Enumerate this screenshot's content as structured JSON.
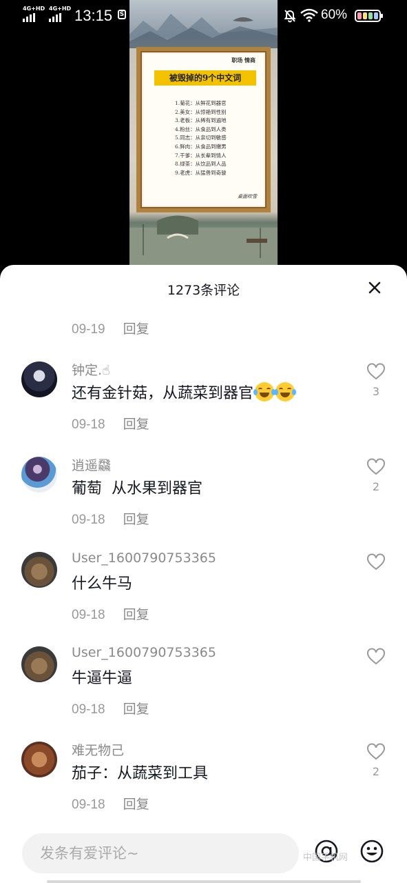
{
  "status_bar": {
    "network_1": "4G+HD",
    "network_2": "4G+HD",
    "time": "13:15",
    "battery_pct": "60%"
  },
  "video": {
    "tag": "职场 情商",
    "title": "被毁掉的9个中文词",
    "items": [
      "1.菊花：从鲜花到器官",
      "2.美女：从惊艳到性别",
      "3.老板：从稀有到遍地",
      "4.粉丝：从食品到人类",
      "5.同志：从亲切到敏感",
      "6.鲜肉：从食品到嫩男",
      "7.干爹：从长辈到情人",
      "8.绿茶：从饮品到人品",
      "9.老虎：从猛兽到奇骏"
    ],
    "signature": "桌面吹雪"
  },
  "sheet": {
    "title": "1273条评论",
    "top_partial": {
      "date": "09-19",
      "reply": "回复"
    },
    "comments": [
      {
        "name": "钟定.",
        "text": "还有金针菇，从蔬菜到器官",
        "date": "09-18",
        "reply": "回复",
        "likes": "3",
        "emojis": 2
      },
      {
        "name": "逍遥飝",
        "text": "葡萄  从水果到器官",
        "date": "09-18",
        "reply": "回复",
        "likes": "2"
      },
      {
        "name": "User_1600790753365",
        "text": "什么牛马",
        "date": "09-18",
        "reply": "回复",
        "likes": ""
      },
      {
        "name": "User_1600790753365",
        "text": "牛逼牛逼",
        "date": "09-18",
        "reply": "回复",
        "likes": ""
      },
      {
        "name": "难无物己",
        "text": "茄子：从蔬菜到工具",
        "date": "09-18",
        "reply": "回复",
        "likes": "2"
      }
    ]
  },
  "input": {
    "placeholder": "发条有爱评论~"
  },
  "watermark": "中国手机网",
  "icons": {
    "close": "close-icon",
    "like": "heart-outline-icon",
    "mention": "at-icon",
    "emoji": "smiley-icon"
  }
}
